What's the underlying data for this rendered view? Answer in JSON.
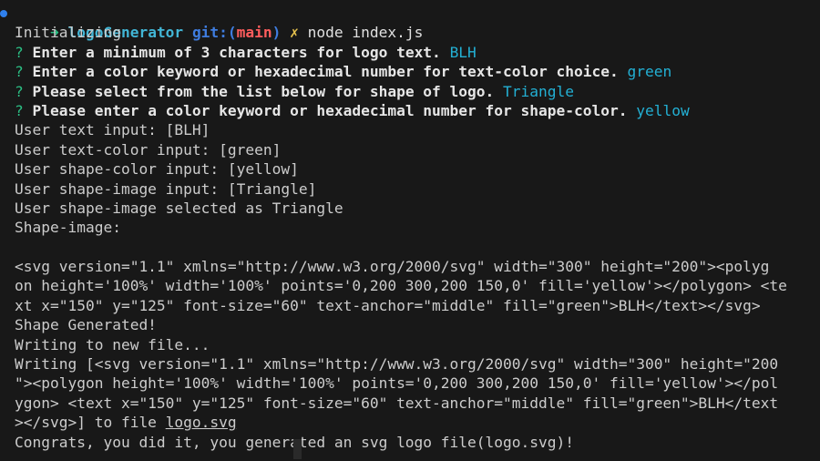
{
  "prompt": {
    "arrow": "➜",
    "dir": "logoGenerator",
    "git_label": "git:(",
    "branch": "main",
    "git_close": ")",
    "dirty": "✗",
    "command": "node index.js"
  },
  "lines": [
    "Initializing",
    "User text input: [BLH]",
    "User text-color input: [green]",
    "User shape-color input: [yellow]",
    "User shape-image input: [Triangle]",
    "User shape-image selected as Triangle",
    "Shape-image:",
    "",
    "<svg version=\"1.1\" xmlns=\"http://www.w3.org/2000/svg\" width=\"300\" height=\"200\"><polyg",
    "on height='100%' width='100%' points='0,200 300,200 150,0' fill='yellow'></polygon> <te",
    "xt x=\"150\" y=\"125\" font-size=\"60\" text-anchor=\"middle\" fill=\"green\">BLH</text></svg>",
    "Shape Generated!",
    "Writing to new file...",
    "Writing [<svg version=\"1.1\" xmlns=\"http://www.w3.org/2000/svg\" width=\"300\" height=\"200",
    "\"><polygon height='100%' width='100%' points='0,200 300,200 150,0' fill='yellow'></pol",
    "ygon> <text x=\"150\" y=\"125\" font-size=\"60\" text-anchor=\"middle\" fill=\"green\">BLH</text",
    "></svg>] to file ",
    "logo.svg",
    "Congrats, you did it, you generated an svg logo file(logo.svg)!"
  ],
  "questions": [
    {
      "mark": "?",
      "text": "Enter a minimum of 3 characters for logo text.",
      "answer": "BLH"
    },
    {
      "mark": "?",
      "text": "Enter a color keyword or hexadecimal number for text-color choice.",
      "answer": "green"
    },
    {
      "mark": "?",
      "text": "Please select from the list below for shape of logo.",
      "answer": "Triangle"
    },
    {
      "mark": "?",
      "text": "Please enter a color keyword or hexadecimal number for shape-color.",
      "answer": "yellow"
    }
  ],
  "colors": {
    "background": "#181818",
    "prompt_arrow": "#2bbf84",
    "directory": "#42b6d6",
    "git": "#3f7de0",
    "branch": "#ff5d5d",
    "answer": "#23b0d4"
  }
}
